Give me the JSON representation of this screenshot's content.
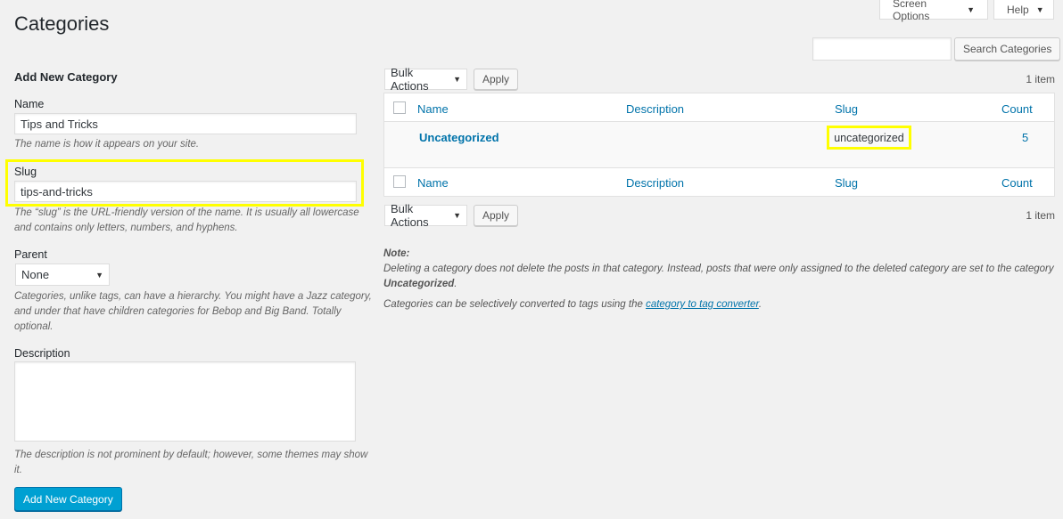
{
  "header": {
    "title": "Categories",
    "screen_options": "Screen Options",
    "help": "Help"
  },
  "search": {
    "value": "",
    "button": "Search Categories"
  },
  "form": {
    "heading": "Add New Category",
    "name_label": "Name",
    "name_value": "Tips and Tricks",
    "name_help": "The name is how it appears on your site.",
    "slug_label": "Slug",
    "slug_value": "tips-and-tricks",
    "slug_help_1": "The “slug” is the URL-friendly version of the name. It is usually all lowercase",
    "slug_help_2": "and contains only letters, numbers, and hyphens.",
    "parent_label": "Parent",
    "parent_value": "None",
    "parent_help_1": "Categories, unlike tags, can have a hierarchy. You might have a Jazz category,",
    "parent_help_2": "and under that have children categories for Bebop and Big Band. Totally",
    "parent_help_3": "optional.",
    "description_label": "Description",
    "description_value": "",
    "description_help_1": "The description is not prominent by default; however, some themes may show",
    "description_help_2": "it.",
    "submit": "Add New Category"
  },
  "table": {
    "bulk_actions": "Bulk Actions",
    "apply": "Apply",
    "item_count": "1 item",
    "columns": [
      "Name",
      "Description",
      "Slug",
      "Count"
    ],
    "rows": [
      {
        "name": "Uncategorized",
        "description": "",
        "slug": "uncategorized",
        "count": "5"
      }
    ]
  },
  "note": {
    "title": "Note:",
    "text": "Deleting a category does not delete the posts in that category. Instead, posts that were only assigned to the deleted category are set to the category",
    "bold": "Uncategorized",
    "period": ".",
    "convert_text": "Categories can be selectively converted to tags using the ",
    "convert_link": "category to tag converter",
    "convert_end": "."
  },
  "colors": {
    "highlight": "#ffff00",
    "primary_button": "#00a0d2",
    "link": "#0073aa"
  }
}
